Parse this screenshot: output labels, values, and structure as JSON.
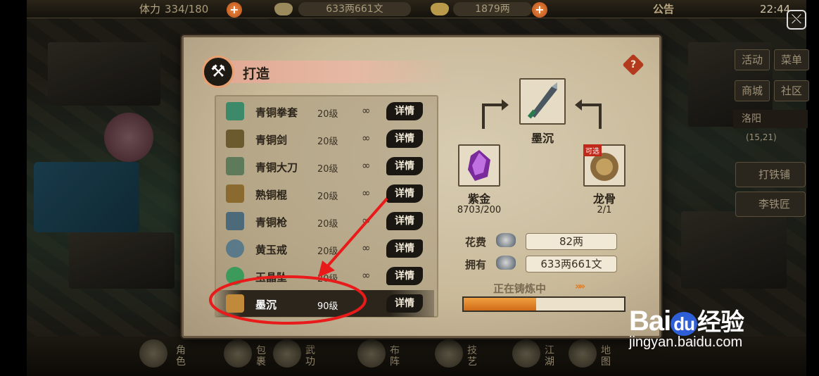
{
  "topbar": {
    "stamina_label": "体力",
    "stamina_value": "334/180",
    "money_value": "633两661文",
    "gold_value": "1879两",
    "notice_label": "公告",
    "time": "22:44"
  },
  "side_menu": {
    "activity": "活动",
    "menu": "菜单",
    "shop": "商城",
    "community": "社区",
    "city": "洛阳",
    "coords": "(15,21)",
    "blacksmith_shop": "打铁铺",
    "blacksmith_npc": "李铁匠"
  },
  "bottom_menu": [
    "角色",
    "包裹",
    "武功",
    "布阵",
    "技艺",
    "江湖",
    "地图"
  ],
  "panel": {
    "title": "打造",
    "help_icon": "?",
    "items": [
      {
        "name": "青铜拳套",
        "level": "20级",
        "count": "∞",
        "detail": "详情",
        "icon": "gauntlet-icon",
        "color": "#3c8a6a"
      },
      {
        "name": "青铜剑",
        "level": "20级",
        "count": "∞",
        "detail": "详情",
        "icon": "sword-icon",
        "color": "#6b5a2e"
      },
      {
        "name": "青铜大刀",
        "level": "20级",
        "count": "∞",
        "detail": "详情",
        "icon": "broadsword-icon",
        "color": "#5d7a5a"
      },
      {
        "name": "熟铜棍",
        "level": "20级",
        "count": "∞",
        "detail": "详情",
        "icon": "staff-icon",
        "color": "#8a6a2e"
      },
      {
        "name": "青铜枪",
        "level": "20级",
        "count": "∞",
        "detail": "详情",
        "icon": "spear-icon",
        "color": "#4d6a7a"
      },
      {
        "name": "黄玉戒",
        "level": "20级",
        "count": "∞",
        "detail": "详情",
        "icon": "ring-icon",
        "color": "#5a7a8a"
      },
      {
        "name": "玉晶坠",
        "level": "20级",
        "count": "∞",
        "detail": "详情",
        "icon": "pendant-icon",
        "color": "#3c9a5a"
      },
      {
        "name": "墨沉",
        "level": "90级",
        "count": "",
        "detail": "详情",
        "icon": "scroll-icon",
        "color": "#c08a3a"
      }
    ],
    "target_name": "墨沉",
    "material1_name": "紫金",
    "material1_count": "8703/200",
    "material2_name": "龙骨",
    "material2_count": "2/1",
    "material2_badge": "可选",
    "cost_label": "花费",
    "cost_value": "82两",
    "own_label": "拥有",
    "own_value": "633两661文",
    "status_text": "正在铸炼中",
    "status_arrows": "»»",
    "progress": 0.45
  },
  "watermark": {
    "bai": "Bai",
    "du": "du",
    "jingyan": "经验",
    "url": "jingyan.baidu.com"
  }
}
